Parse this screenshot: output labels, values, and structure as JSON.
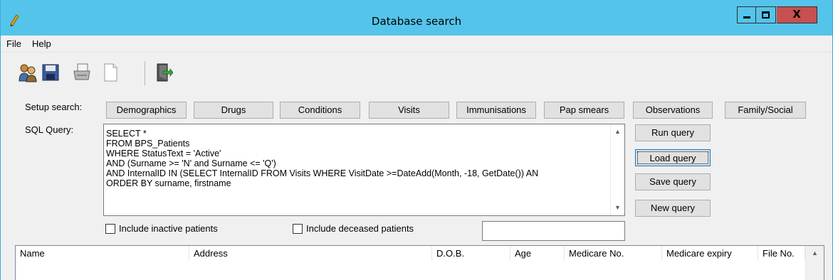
{
  "window": {
    "title": "Database search",
    "close_glyph": "X"
  },
  "menu": [
    "File",
    "Help"
  ],
  "toolbar": {
    "icons": [
      "users-icon",
      "save-icon",
      "printer-icon",
      "new-document-icon",
      "exit-icon"
    ]
  },
  "setup_search": {
    "label": "Setup search:",
    "buttons": [
      "Demographics",
      "Drugs",
      "Conditions",
      "Visits",
      "Immunisations",
      "Pap smears",
      "Observations",
      "Family/Social"
    ]
  },
  "sql_query": {
    "label": "SQL Query:",
    "lines": [
      "SELECT *",
      "FROM BPS_Patients",
      "WHERE StatusText = 'Active'",
      "AND (Surname >= 'N' and Surname <= 'Q')",
      "AND InternalID IN (SELECT InternalID FROM Visits WHERE VisitDate >=DateAdd(Month, -18, GetDate()) AN",
      "ORDER BY surname, firstname"
    ]
  },
  "query_buttons": {
    "run": "Run query",
    "load": "Load query",
    "save": "Save query",
    "new": "New query"
  },
  "options": {
    "include_inactive": {
      "label": "Include inactive patients",
      "checked": false
    },
    "include_deceased": {
      "label": "Include deceased patients",
      "checked": false
    }
  },
  "status_field": {
    "value": ""
  },
  "results": {
    "columns": [
      "Name",
      "Address",
      "D.O.B.",
      "Age",
      "Medicare No.",
      "Medicare expiry",
      "File No."
    ],
    "rows": []
  },
  "colors": {
    "titlebar": "#55c4ea",
    "close_button": "#c75050",
    "window_bg": "#f0f0f0"
  }
}
